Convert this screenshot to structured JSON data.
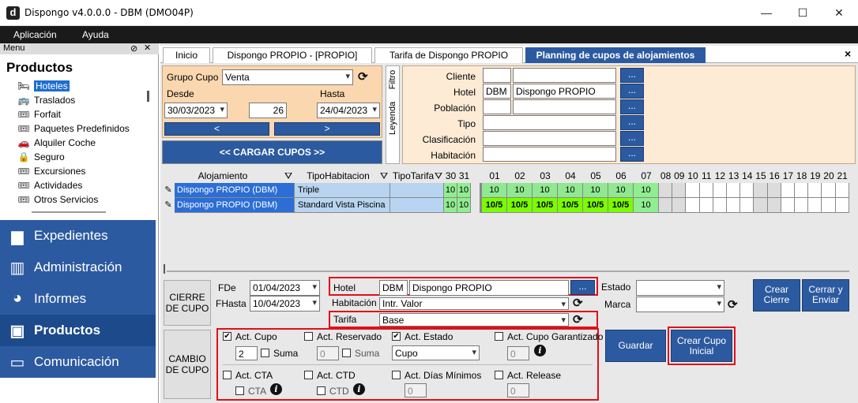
{
  "window": {
    "logo": "d",
    "title": "Dispongo v4.0.0.0 - DBM (DMO04P)",
    "minimize": "—",
    "maximize": "☐",
    "close": "✕"
  },
  "menubar": {
    "items": [
      "Aplicación",
      "Ayuda"
    ]
  },
  "leftpanel": {
    "menu_label": "Menu",
    "section_title": "Productos",
    "items": [
      {
        "label": "Hoteles",
        "icon": "bed-icon",
        "glyph": "🛏"
      },
      {
        "label": "Traslados",
        "icon": "bus-icon",
        "glyph": "🚌"
      },
      {
        "label": "Forfait",
        "icon": "ticket-icon",
        "glyph": "🎟"
      },
      {
        "label": "Paquetes Predefinidos",
        "icon": "ticket-icon",
        "glyph": "🎟"
      },
      {
        "label": "Alquiler Coche",
        "icon": "car-icon",
        "glyph": "🚗"
      },
      {
        "label": "Seguro",
        "icon": "lock-icon",
        "glyph": "🔒"
      },
      {
        "label": "Excursiones",
        "icon": "ticket-icon",
        "glyph": "🎟"
      },
      {
        "label": "Actividades",
        "icon": "ticket-icon",
        "glyph": "🎟"
      },
      {
        "label": "Otros Servicios",
        "icon": "ticket-icon",
        "glyph": "🎟"
      }
    ],
    "nav": [
      {
        "label": "Expedientes",
        "icon": "folder-icon",
        "glyph": "▆"
      },
      {
        "label": "Administración",
        "icon": "bar-chart-icon",
        "glyph": "▥"
      },
      {
        "label": "Informes",
        "icon": "pie-chart-icon",
        "glyph": "◕"
      },
      {
        "label": "Productos",
        "icon": "briefcase-icon",
        "glyph": "▣"
      },
      {
        "label": "Comunicación",
        "icon": "monitor-icon",
        "glyph": "▭"
      }
    ]
  },
  "tabs": [
    "Inicio",
    "Dispongo PROPIO - [PROPIO]",
    "Tarifa de Dispongo PROPIO",
    "Planning de cupos de alojamientos"
  ],
  "tab_close": "×",
  "grupo": {
    "label": "Grupo Cupo",
    "value": "Venta",
    "desde_label": "Desde",
    "desde": "30/03/2023",
    "days": "26",
    "hasta_label": "Hasta",
    "hasta": "24/04/2023",
    "prev": "<",
    "next": ">",
    "cargar": "<< CARGAR CUPOS >>"
  },
  "side_tabs": {
    "filtro": "Filtro",
    "leyenda": "Leyenda"
  },
  "filtro": {
    "cliente_label": "Cliente",
    "hotel_label": "Hotel",
    "hotel_code": "DBM",
    "hotel_name": "Dispongo PROPIO",
    "poblacion_label": "Población",
    "tipo_label": "Tipo",
    "clasificacion_label": "Clasificación",
    "habitacion_label": "Habitación",
    "dots": "..."
  },
  "grid": {
    "headers": {
      "alojamiento": "Alojamiento",
      "tipohab": "TipoHabitacion",
      "tipotarifa": "TipoTarifa"
    },
    "days": [
      "30",
      "31",
      "01",
      "02",
      "03",
      "04",
      "05",
      "06",
      "07",
      "08",
      "09",
      "10",
      "11",
      "12",
      "13",
      "14",
      "15",
      "16",
      "17",
      "18",
      "19",
      "20",
      "21"
    ],
    "rows": [
      {
        "aloj": "Dispongo PROPIO (DBM)",
        "tipo": "Triple",
        "vals": [
          "10",
          "10",
          "10",
          "10",
          "10",
          "10",
          "10",
          "10",
          "10"
        ]
      },
      {
        "aloj": "Dispongo PROPIO (DBM)",
        "tipo": "Standard Vista Piscina",
        "vals": [
          "10",
          "10",
          "10/5",
          "10/5",
          "10/5",
          "10/5",
          "10/5",
          "10/5",
          "10"
        ]
      }
    ]
  },
  "cierre": {
    "section": "CIERRE DE CUPO",
    "fde_label": "FDe",
    "fde": "01/04/2023",
    "fhasta_label": "FHasta",
    "fhasta": "10/04/2023",
    "hotel_label": "Hotel",
    "hotel_code": "DBM",
    "hotel_name": "Dispongo PROPIO",
    "habitacion_label": "Habitación",
    "habitacion": "Intr. Valor",
    "tarifa_label": "Tarifa",
    "tarifa": "Base",
    "estado_label": "Estado",
    "marca_label": "Marca",
    "crear_cierre": "Crear Cierre",
    "cerrar_enviar": "Cerrar y Enviar"
  },
  "cambio": {
    "section": "CAMBIO DE CUPO",
    "act_cupo": "Act. Cupo",
    "cupo_val": "2",
    "suma": "Suma",
    "act_reservado": "Act. Reservado",
    "reservado_val": "0",
    "act_estado": "Act. Estado",
    "estado_val": "Cupo",
    "act_cupo_garantizado": "Act. Cupo Garantizado",
    "garantizado_val": "0",
    "act_cta": "Act. CTA",
    "cta": "CTA",
    "act_ctd": "Act. CTD",
    "ctd": "CTD",
    "act_dias_minimos": "Act. Días Mínimos",
    "dias_val": "0",
    "act_release": "Act. Release",
    "release_val": "0",
    "guardar": "Guardar",
    "crear_cupo_inicial": "Crear Cupo Inicial"
  },
  "colors": {
    "accent": "#2c5aa0",
    "green": "#90ee90",
    "green_bright": "#7cfc00",
    "highlight": "#e0101a"
  }
}
